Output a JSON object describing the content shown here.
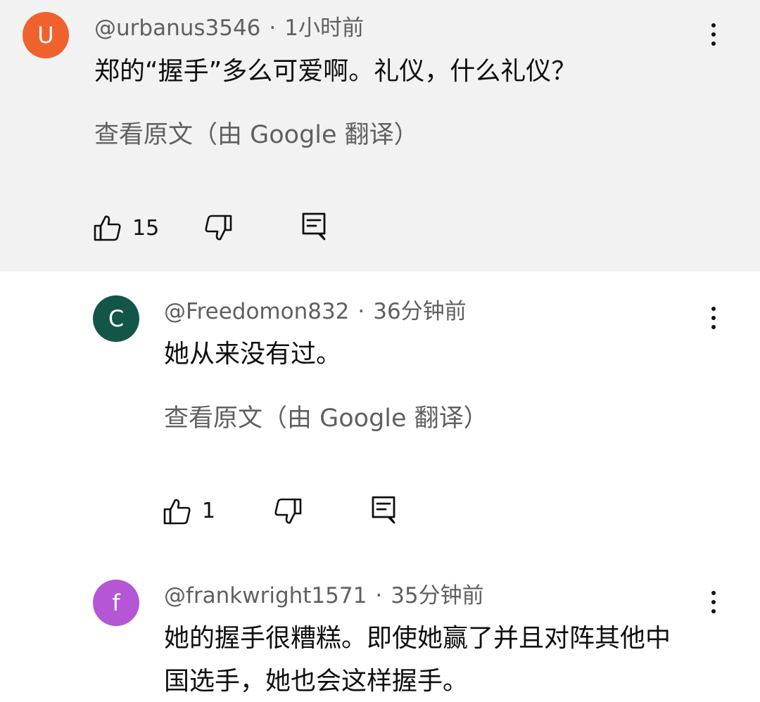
{
  "comments": [
    {
      "avatar_letter": "U",
      "avatar_color": "#f0622d",
      "username": "@urbanus3546",
      "separator": "·",
      "time": "1小时前",
      "lines": [
        "郑的“握手”多么可爱啊。礼仪，什么礼仪？"
      ],
      "translate_link": "查看原文（由 Google 翻译）",
      "likes": "15"
    },
    {
      "avatar_letter": "C",
      "avatar_color": "#14554a",
      "username": "@Freedomon832",
      "separator": "·",
      "time": "36分钟前",
      "lines": [
        "她从来没有过。"
      ],
      "translate_link": "查看原文（由 Google 翻译）",
      "likes": "1"
    },
    {
      "avatar_letter": "f",
      "avatar_color": "#b556d4",
      "username": "@frankwright1571",
      "separator": "·",
      "time": "35分钟前",
      "lines": [
        "她的握手很糟糕。即使她赢了并且对阵其他中",
        "国选手，她也会这样握手。"
      ]
    }
  ],
  "icons": {
    "like": "thumbs-up-icon",
    "dislike": "thumbs-down-icon",
    "reply": "reply-icon",
    "more": "more-vert-icon"
  }
}
